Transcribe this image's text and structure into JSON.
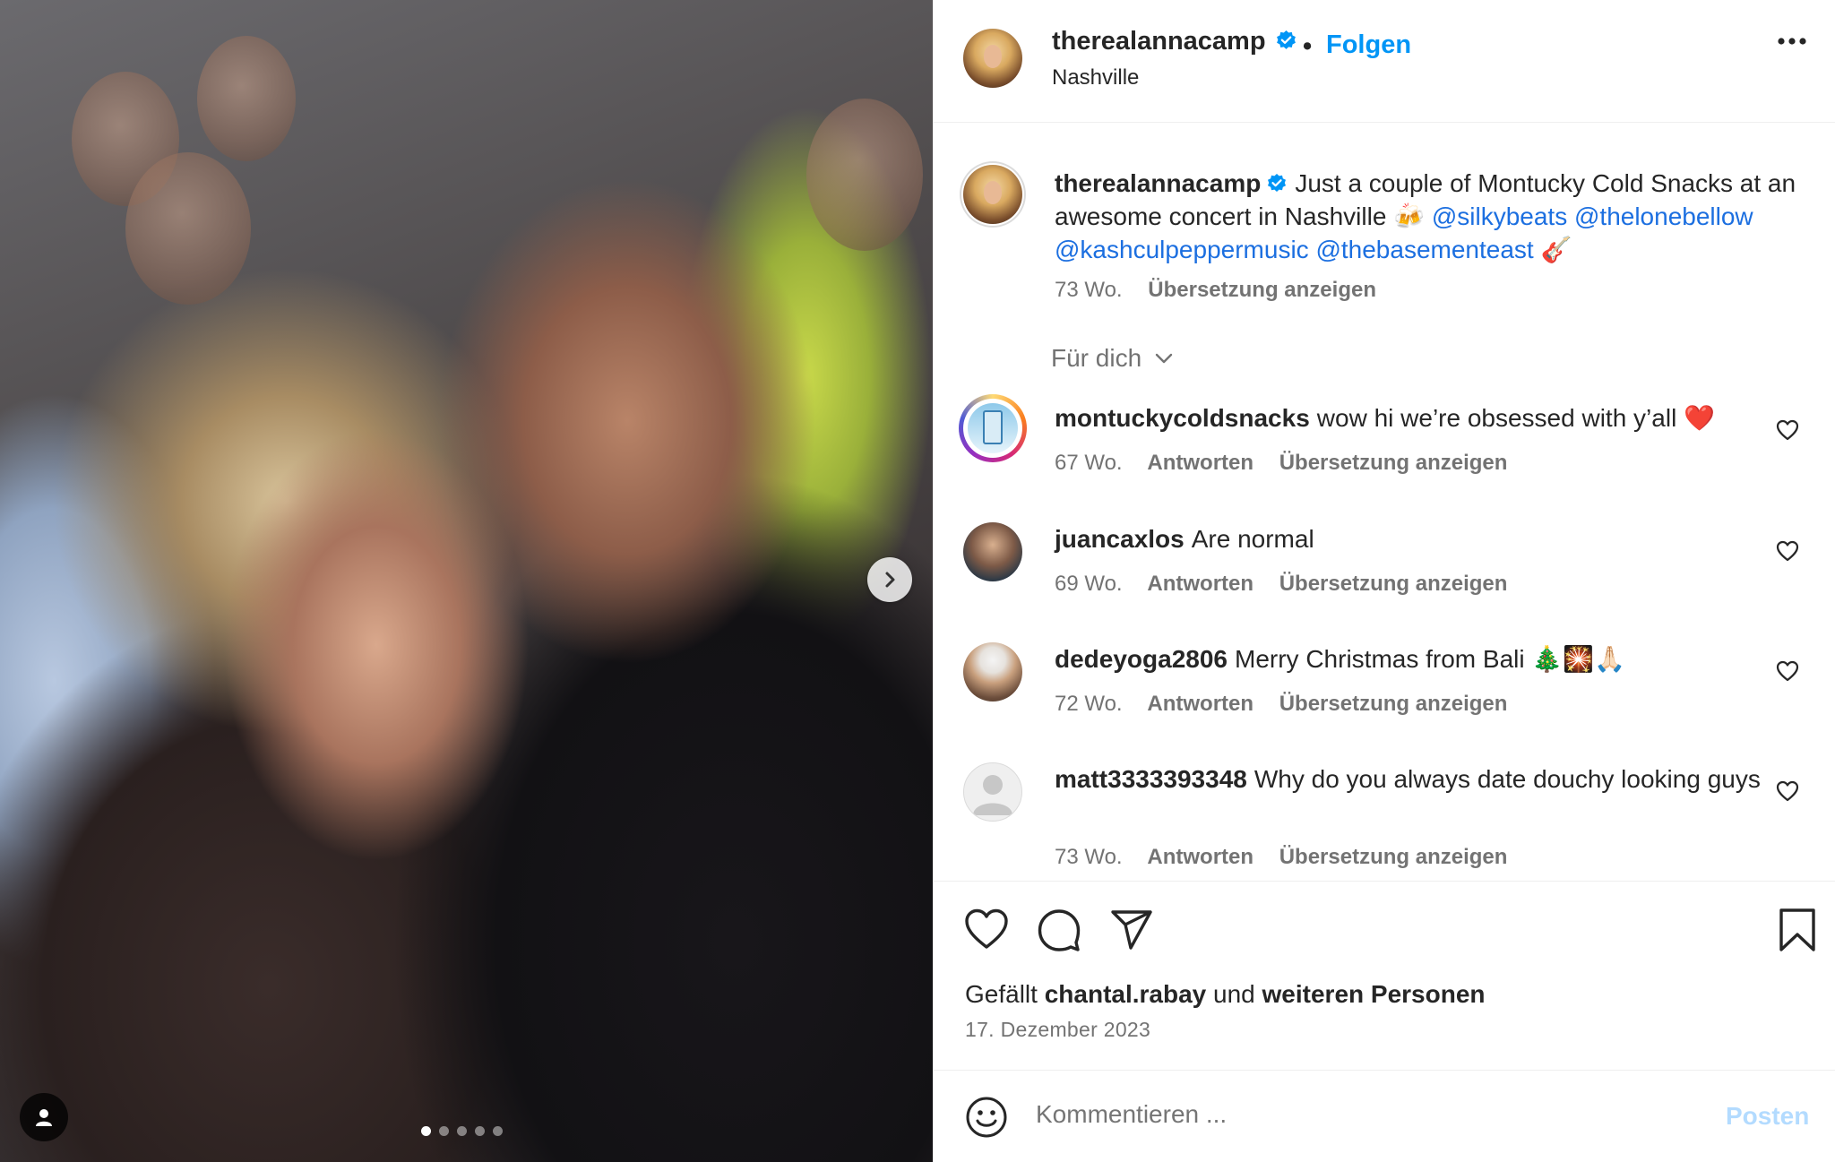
{
  "post": {
    "author": "therealannacamp",
    "follow_label": "Folgen",
    "separator": "•",
    "location": "Nashville",
    "carousel": {
      "slide_count": 5,
      "active_index": 0
    }
  },
  "caption": {
    "username": "therealannacamp",
    "text_part1": "Just a couple of Montucky Cold Snacks at an awesome concert in Nashville",
    "emoji1": "🍻",
    "mentions": [
      "@silkybeats",
      "@thelonebellow",
      "@kashculpeppermusic",
      "@thebasementeast"
    ],
    "emoji2": "🎸",
    "age": "73 Wo.",
    "translate": "Übersetzung anzeigen"
  },
  "sort": {
    "label": "Für dich"
  },
  "comments": [
    {
      "username": "montuckycoldsnacks",
      "text": "wow hi we’re obsessed with y’all ❤️",
      "age": "67 Wo.",
      "reply": "Antworten",
      "translate": "Übersetzung anzeigen"
    },
    {
      "username": "juancaxlos",
      "text": "Are normal",
      "age": "69 Wo.",
      "reply": "Antworten",
      "translate": "Übersetzung anzeigen"
    },
    {
      "username": "dedeyoga2806",
      "text": "Merry Christmas from Bali 🎄🎇🙏🏻",
      "age": "72 Wo.",
      "reply": "Antworten",
      "translate": "Übersetzung anzeigen"
    },
    {
      "username": "matt3333393348",
      "text": "Why do you always date douchy looking guys",
      "age": "73 Wo.",
      "reply": "Antworten",
      "translate": "Übersetzung anzeigen"
    }
  ],
  "likes": {
    "prefix": "Gefällt",
    "user": "chantal.rabay",
    "middle": "und",
    "others": "weiteren Personen"
  },
  "date": "17. Dezember 2023",
  "composer": {
    "placeholder": "Kommentieren ...",
    "post_label": "Posten"
  },
  "colors": {
    "link": "#1c6fe0",
    "follow": "#0095f6",
    "post_disabled": "#b3dbff",
    "verified": "#0095f6"
  },
  "icons": [
    "more-icon",
    "verified-icon",
    "heart-icon",
    "comment-icon",
    "share-icon",
    "bookmark-icon",
    "emoji-icon",
    "chevron-down-icon",
    "chevron-right-icon",
    "user-tag-icon"
  ]
}
